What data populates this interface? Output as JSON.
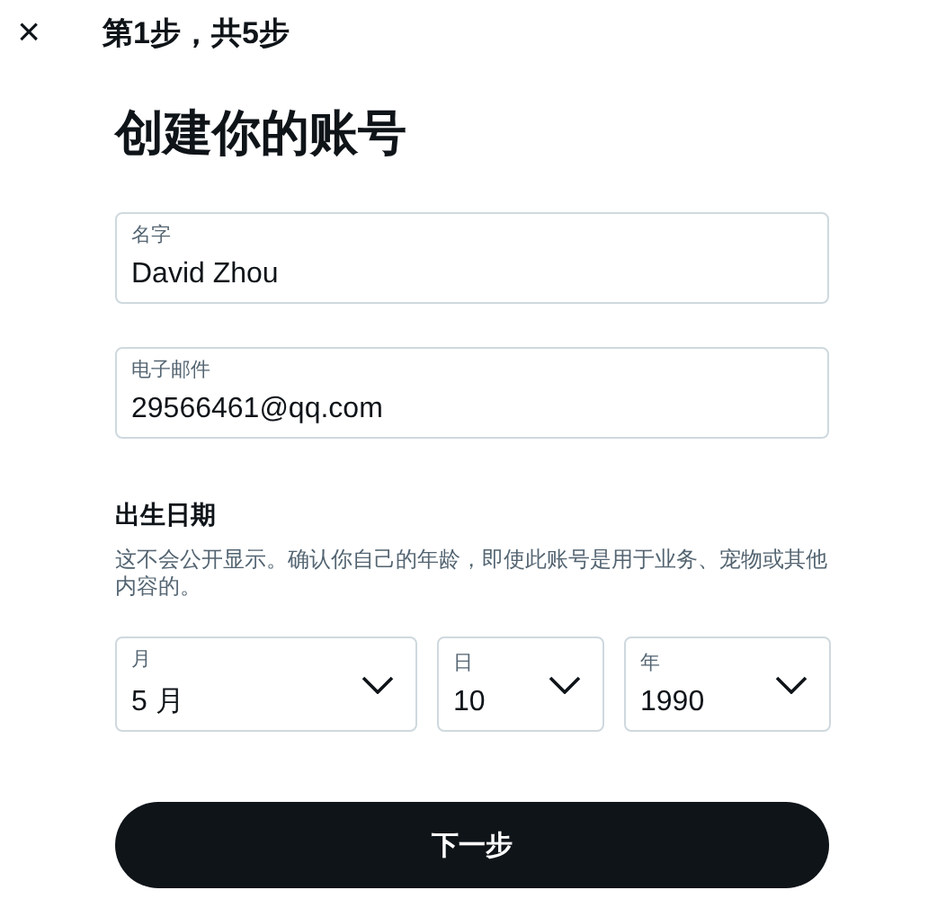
{
  "header": {
    "close": "×",
    "step": "第1步，共5步"
  },
  "title": "创建你的账号",
  "fields": [
    {
      "label": "名字",
      "value": "David Zhou"
    },
    {
      "label": "电子邮件",
      "value": "29566461@qq.com"
    }
  ],
  "birthdate": {
    "heading": "出生日期",
    "description": "这不会公开显示。确认你自己的年龄，即使此账号是用于业务、宠物或其他内容的。",
    "selects": [
      {
        "label": "月",
        "value": "5 月"
      },
      {
        "label": "日",
        "value": "10"
      },
      {
        "label": "年",
        "value": "1990"
      }
    ]
  },
  "next_button": "下一步"
}
